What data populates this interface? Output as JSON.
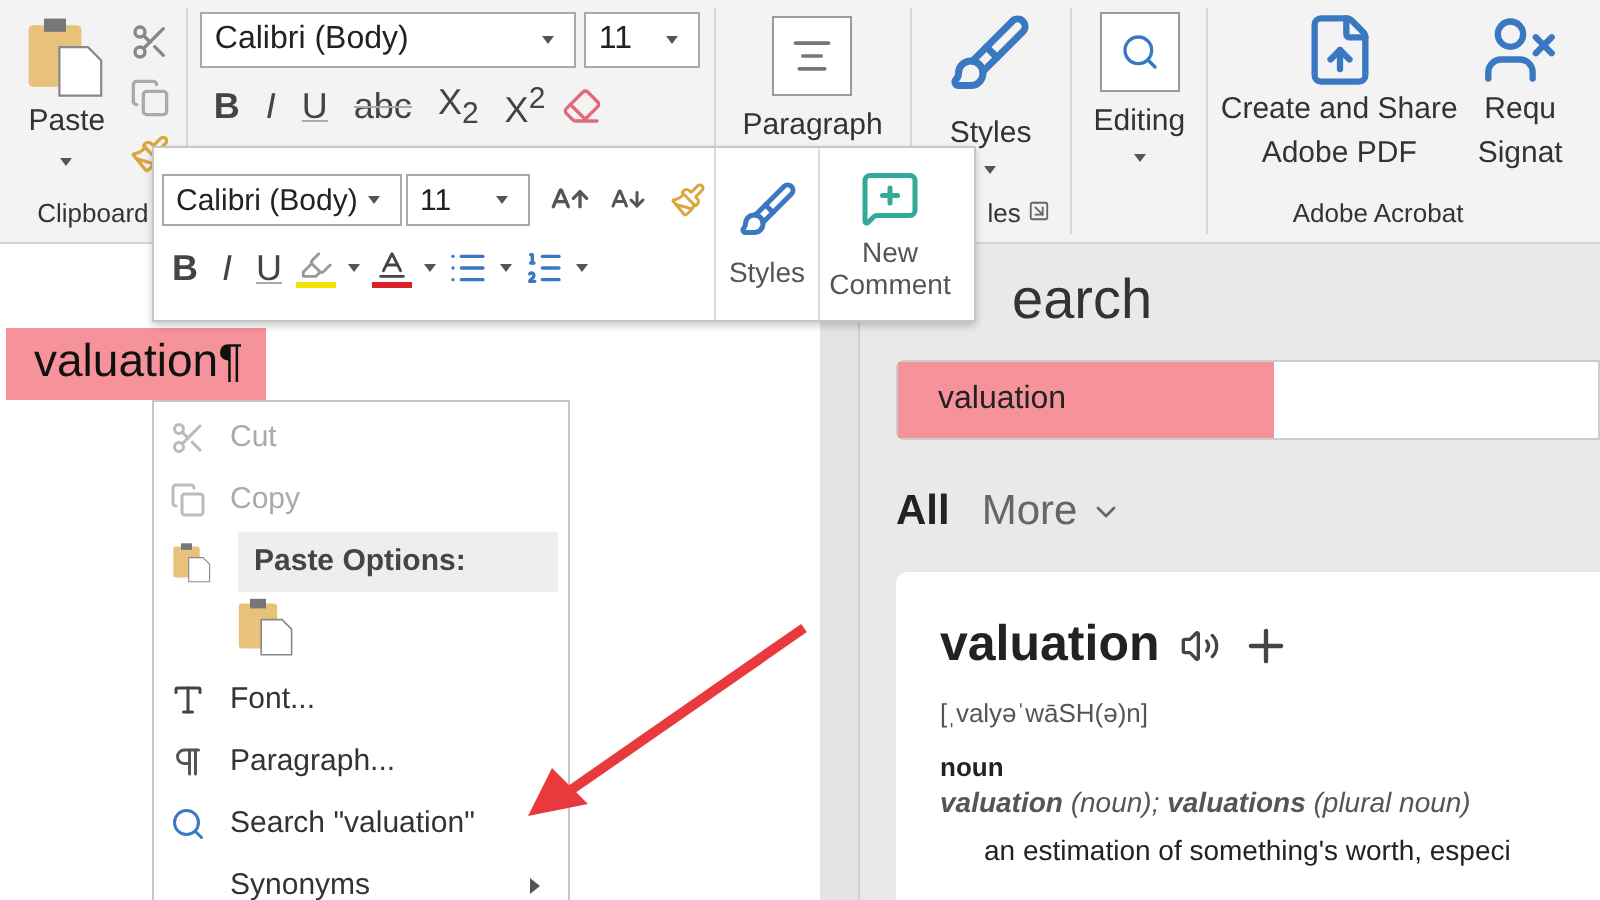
{
  "ribbon": {
    "groups": [
      {
        "kind": "clipboard",
        "button": "Paste",
        "label": "Clipboard"
      },
      {
        "kind": "font",
        "font_name": "Calibri (Body)",
        "font_size": "11",
        "buttons": [
          {
            "kind": "bold",
            "label": "B"
          },
          {
            "kind": "italic",
            "label": "I"
          },
          {
            "kind": "underline",
            "label": "U"
          },
          {
            "kind": "strike",
            "label": "abc"
          },
          {
            "kind": "plain",
            "label": "X$_{2}$"
          },
          {
            "kind": "plain",
            "label": "X$^{2}$"
          }
        ]
      },
      {
        "kind": "paragraph",
        "button": "Paragraph"
      },
      {
        "kind": "styles",
        "button": "Styles",
        "label": "les"
      },
      {
        "kind": "editing",
        "button": "Editing"
      },
      {
        "kind": "acrobat",
        "buttons": [
          {
            "kind": "share",
            "lines": [
              "Create and Share",
              "Adobe PDF"
            ]
          },
          {
            "kind": "person",
            "lines": [
              "Requ",
              "Signat"
            ]
          }
        ],
        "label": "Adobe Acrobat"
      }
    ]
  },
  "mini_toolbar": {
    "font_name": "Calibri (Body)",
    "font_size": "11",
    "format_buttons": [
      {
        "kind": "bold",
        "label": "B"
      },
      {
        "kind": "italic",
        "label": "I"
      },
      {
        "kind": "underline",
        "label": "U"
      }
    ],
    "styles": "Styles",
    "new_comment": "New Comment"
  },
  "document": {
    "text": "valuation¶"
  },
  "context_menu": {
    "items": [
      {
        "kind": "cut",
        "label": "Cut",
        "disabled": true
      },
      {
        "kind": "copy",
        "label": "Copy",
        "disabled": true
      },
      {
        "kind": "header",
        "label": "Paste Options:"
      },
      {
        "kind": "paste"
      },
      {
        "kind": "font",
        "label": "Font...",
        "disabled": false
      },
      {
        "kind": "paragraph",
        "label": "Paragraph...",
        "disabled": false
      },
      {
        "kind": "search",
        "label": "Search \"valuation\"",
        "disabled": false
      },
      {
        "kind": "submenu",
        "label": "Synonyms",
        "disabled": false
      }
    ]
  },
  "search_pane": {
    "title": "earch",
    "query": "valuation",
    "tabs": [
      {
        "label": "All",
        "selected": true
      },
      {
        "label": "More",
        "selected": false
      }
    ],
    "entry": {
      "word": "valuation",
      "pronunciation": "[ˌvalyəˈwāSH(ə)n]",
      "part_of_speech": "noun",
      "forms": "**valuation** (noun); **valuations** (plural noun)",
      "definition": "an estimation of something's worth, especi"
    }
  }
}
